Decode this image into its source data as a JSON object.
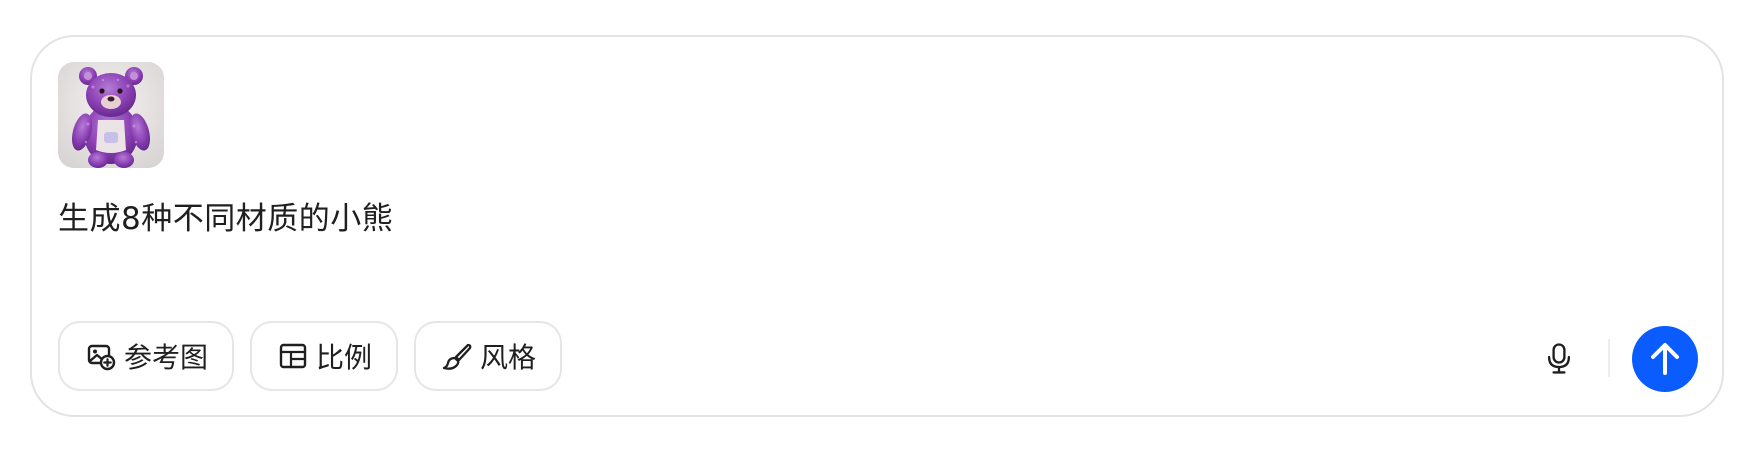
{
  "composer": {
    "attachment": {
      "icon": "teddy-bear-image"
    },
    "prompt": "生成8种不同材质的小熊",
    "chips": [
      {
        "label": "参考图",
        "icon": "image-add-icon"
      },
      {
        "label": "比例",
        "icon": "aspect-ratio-icon"
      },
      {
        "label": "风格",
        "icon": "brush-icon"
      }
    ],
    "mic": {
      "icon": "microphone-icon"
    },
    "send": {
      "icon": "arrow-up-icon",
      "color": "#0a5cff"
    }
  }
}
